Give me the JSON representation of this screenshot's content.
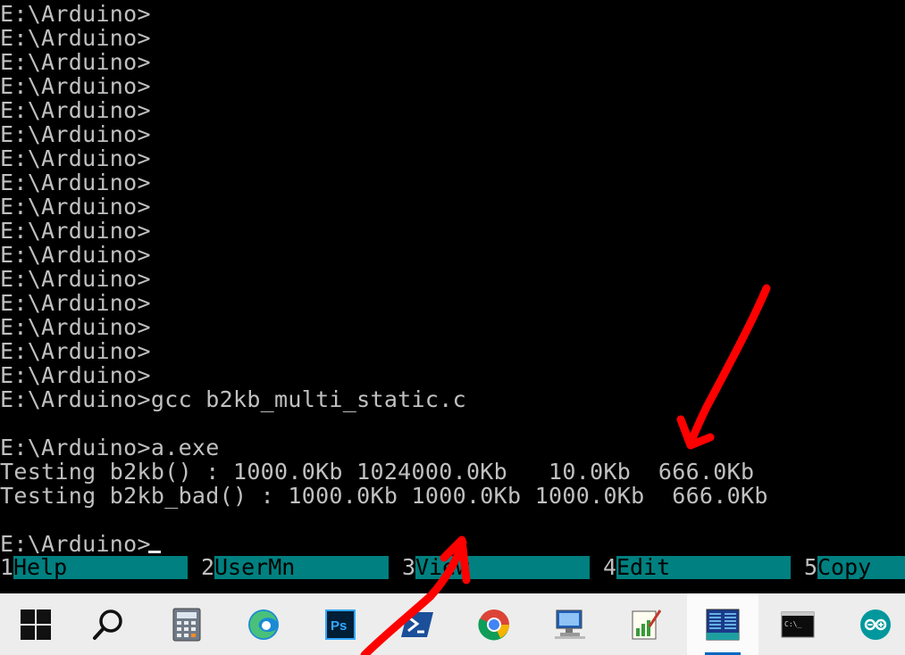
{
  "terminal": {
    "lines": [
      "E:\\Arduino>",
      "E:\\Arduino>",
      "E:\\Arduino>",
      "E:\\Arduino>",
      "E:\\Arduino>",
      "E:\\Arduino>",
      "E:\\Arduino>",
      "E:\\Arduino>",
      "E:\\Arduino>",
      "E:\\Arduino>",
      "E:\\Arduino>",
      "E:\\Arduino>",
      "E:\\Arduino>",
      "E:\\Arduino>",
      "E:\\Arduino>",
      "E:\\Arduino>",
      "E:\\Arduino>gcc b2kb_multi_static.c",
      "",
      "E:\\Arduino>a.exe",
      "Testing b2kb() : 1000.0Kb 1024000.0Kb   10.0Kb  666.0Kb",
      "Testing b2kb_bad() : 1000.0Kb 1000.0Kb 1000.0Kb  666.0Kb",
      "",
      "E:\\Arduino>"
    ]
  },
  "fkeys": [
    {
      "num": "1",
      "label": "Help"
    },
    {
      "num": "2",
      "label": "UserMn"
    },
    {
      "num": "3",
      "label": "View"
    },
    {
      "num": "4",
      "label": "Edit"
    },
    {
      "num": "5",
      "label": "Copy"
    }
  ],
  "taskbar": {
    "items": [
      {
        "name": "start",
        "icon": "windows-logo-icon"
      },
      {
        "name": "search",
        "icon": "search-icon"
      },
      {
        "name": "calculator",
        "icon": "calculator-icon"
      },
      {
        "name": "edge",
        "icon": "edge-browser-icon"
      },
      {
        "name": "photoshop",
        "icon": "photoshop-icon",
        "text": "Ps"
      },
      {
        "name": "powershell",
        "icon": "powershell-icon"
      },
      {
        "name": "chrome",
        "icon": "chrome-icon"
      },
      {
        "name": "remote-desktop",
        "icon": "remote-desktop-icon"
      },
      {
        "name": "notepad-chart",
        "icon": "notepad-chart-icon"
      },
      {
        "name": "far-manager",
        "icon": "far-manager-icon",
        "active": true
      },
      {
        "name": "command-prompt",
        "icon": "cmd-icon",
        "text": "C:\\_"
      },
      {
        "name": "arduino",
        "icon": "arduino-icon"
      }
    ]
  },
  "colors": {
    "terminal_bg": "#000000",
    "terminal_fg": "#c0c0c0",
    "fkey_bg": "#008080",
    "annotation": "#ff0000",
    "taskbar_bg": "#ededed"
  }
}
